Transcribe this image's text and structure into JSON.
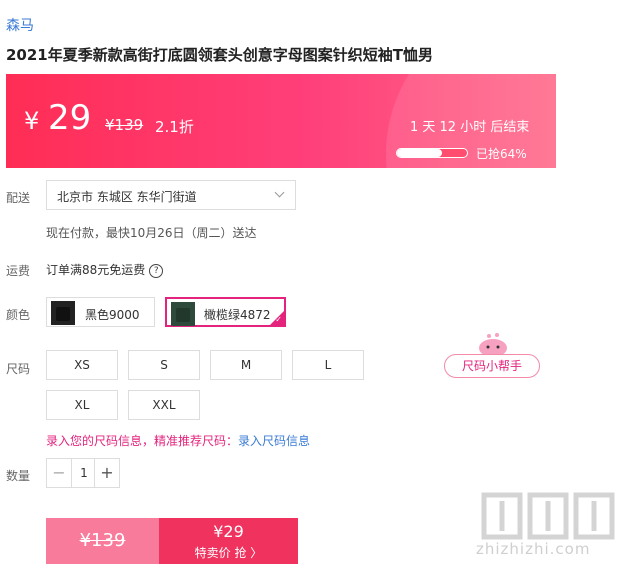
{
  "brand": "森马",
  "product_title": "2021年夏季新款高街打底圆领套头创意字母图案针织短袖T恤男",
  "promo": {
    "currency": "¥",
    "price": "29",
    "original_price": "¥139",
    "discount": "2.1折",
    "countdown": "1 天 12 小时 后结束",
    "sold_progress": 0.64,
    "sold_text": "已抢64%"
  },
  "delivery": {
    "label": "配送",
    "address": "北京市 东城区 东华门街道",
    "eta": "现在付款，最快10月26日（周二）送达"
  },
  "shipping": {
    "label": "运费",
    "text": "订单满88元免运费",
    "help_icon": "?"
  },
  "color": {
    "label": "颜色",
    "options": [
      {
        "label": "黑色9000",
        "selected": false
      },
      {
        "label": "橄榄绿4872",
        "selected": true
      }
    ]
  },
  "size": {
    "label": "尺码",
    "options": [
      "XS",
      "S",
      "M",
      "L",
      "XL",
      "XXL"
    ],
    "helper_button": "尺码小帮手",
    "tip": "录入您的尺码信息，精准推荐尺码：",
    "tip_link": "录入尺码信息"
  },
  "quantity": {
    "label": "数量",
    "value": "1",
    "minus": "−",
    "plus": "+"
  },
  "buy": {
    "original_price": "¥139",
    "price": "¥29",
    "label": "特卖价 抢 〉"
  },
  "watermark": {
    "text": "zhizhizhi.com"
  },
  "colors": {
    "accent": "#e4237d",
    "banner": "#ff2d55",
    "link": "#3a7bd5"
  }
}
